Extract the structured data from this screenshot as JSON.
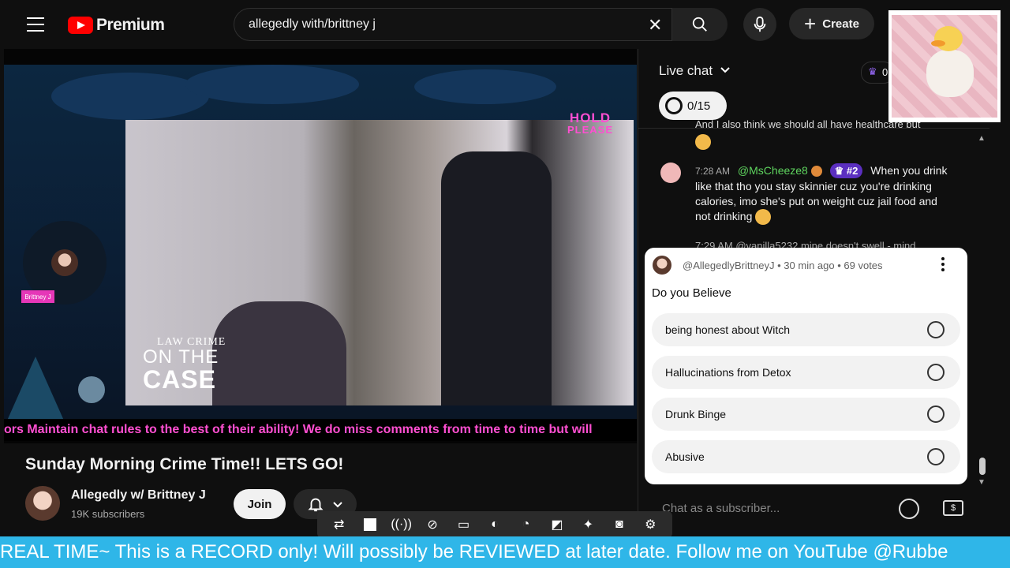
{
  "topbar": {
    "logo_text": "Premium",
    "search_value": "allegedly with/brittney j",
    "create_label": "Create"
  },
  "video": {
    "hold_text_line1": "HOLD",
    "hold_text_line2": "PLEASE",
    "lawcrime_line1": "LAW CRIME",
    "lawcrime_line2": "ON THE",
    "lawcrime_line3": "CASE",
    "host_tag": "Brittney J",
    "ticker_text": "ors Maintain chat rules to the best of their ability! We do miss comments from time to time but will"
  },
  "video_info": {
    "title": "Sunday Morning Crime Time!! LETS GO!",
    "channel_name": "Allegedly w/ Brittney J",
    "subscribers": "19K subscribers",
    "join_label": "Join"
  },
  "chat": {
    "header_label": "Live chat",
    "crown_count": "0",
    "goal_text": "0/15",
    "prev_message": "And I also think we should all have healthcare but",
    "message1": {
      "time": "7:28 AM",
      "user": "@MsCheeze8",
      "rank": "#2",
      "text": "When you drink like that tho you stay skinnier cuz you're drinking calories, imo she's put on weight cuz jail food and not drinking"
    },
    "message2": {
      "time": "7:29 AM",
      "user": "@vanilla5232",
      "text": "mine doesn't swell - mind"
    },
    "input_placeholder": "Chat as a subscriber..."
  },
  "poll": {
    "meta": "@AllegedlyBrittneyJ • 30 min ago • 69 votes",
    "question": "Do you Believe",
    "options": [
      "being honest about Witch",
      "Hallucinations from Detox",
      "Drunk Binge",
      "Abusive"
    ]
  },
  "banner": {
    "text": "REAL TIME~ This is a RECORD only! Will possibly be REVIEWED at later date. Follow me on YouTube @Rubbe"
  },
  "colors": {
    "accent_pink": "#ff4fd1",
    "banner_blue": "#2fb6e8",
    "yt_red": "#ff0000",
    "chat_user_green": "#5fd55f",
    "rank_purple": "#5b2fc0"
  }
}
